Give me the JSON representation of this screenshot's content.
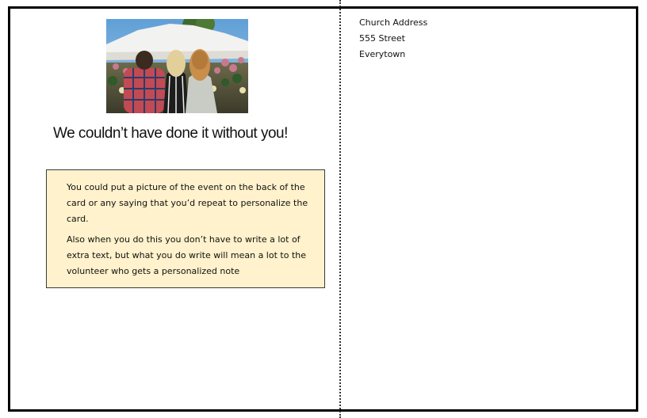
{
  "front": {
    "photo_icon": "event-crowd-photo",
    "headline": "We couldn’t have done it without you!",
    "note": {
      "paragraph_1": "You could put a picture of the event on the back of the card or any saying that you’d repeat to personalize the card.",
      "paragraph_2": "Also when you do this you don’t have to write a lot of extra text, but what you do write will mean a lot to the volunteer who gets a personalized note"
    },
    "note_background": "#fff2cc"
  },
  "back": {
    "address": {
      "line_1": "Church Address",
      "line_2": "555 Street",
      "line_3": "Everytown"
    }
  },
  "colors": {
    "border": "#000000",
    "fold_line": "#333333"
  }
}
